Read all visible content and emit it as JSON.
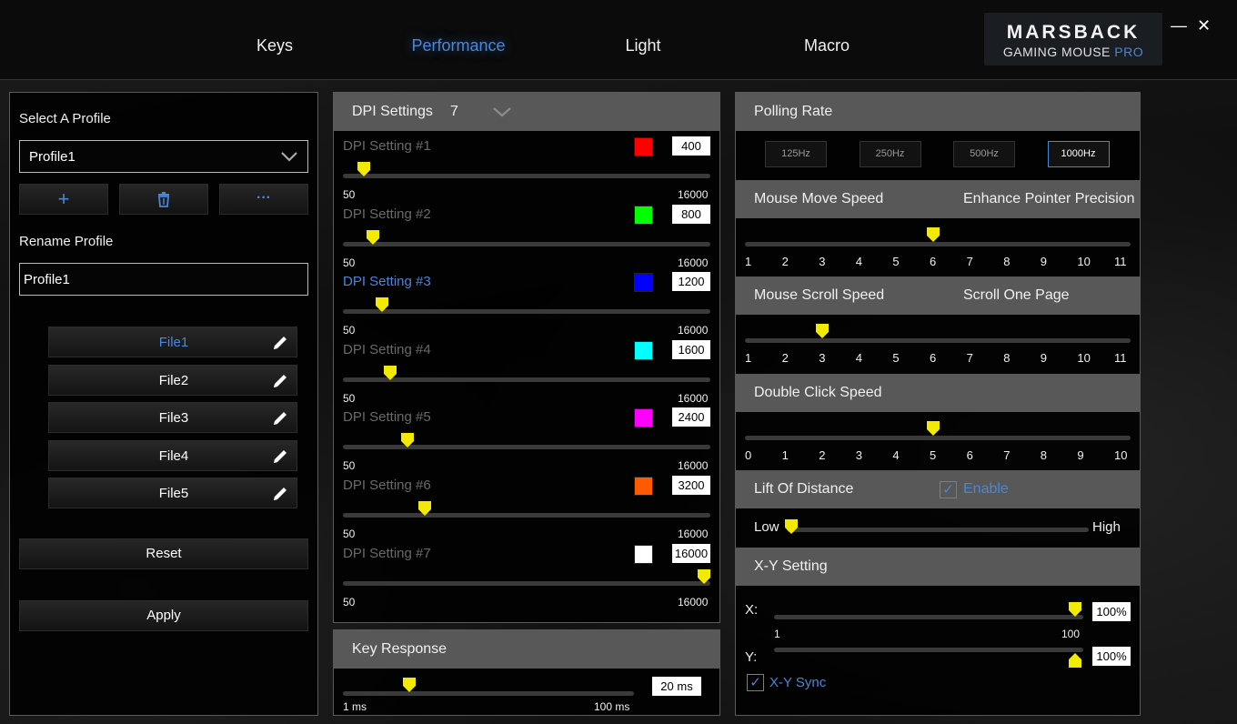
{
  "nav": {
    "tabs": [
      "Keys",
      "Performance",
      "Light",
      "Macro"
    ],
    "active": "Performance"
  },
  "logo": {
    "brand": "MARSBACK",
    "line": "GAMING MOUSE",
    "pro": "PRO"
  },
  "window": {
    "minimize": "—",
    "close": "✕"
  },
  "profile": {
    "select_label": "Select A Profile",
    "selected": "Profile1",
    "actions": {
      "add": "+",
      "delete": "🗑",
      "more": "···"
    },
    "rename_label": "Rename Profile",
    "rename_value": "Profile1",
    "files": [
      "File1",
      "File2",
      "File3",
      "File4",
      "File5"
    ],
    "active_file": "File1",
    "reset": "Reset",
    "apply": "Apply"
  },
  "dpi": {
    "header": "DPI Settings",
    "count": "7",
    "min_label": "50",
    "max_label": "16000",
    "settings": [
      {
        "label": "DPI Setting #1",
        "color": "#ff0000",
        "value": "400"
      },
      {
        "label": "DPI Setting #2",
        "color": "#00ff00",
        "value": "800"
      },
      {
        "label": "DPI Setting #3",
        "color": "#0000ff",
        "value": "1200"
      },
      {
        "label": "DPI Setting #4",
        "color": "#00ffff",
        "value": "1600"
      },
      {
        "label": "DPI Setting #5",
        "color": "#ff00ff",
        "value": "2400"
      },
      {
        "label": "DPI Setting #6",
        "color": "#ff5a00",
        "value": "3200"
      },
      {
        "label": "DPI Setting #7",
        "color": "#ffffff",
        "value": "16000"
      }
    ],
    "active_index": 2
  },
  "key_response": {
    "header": "Key Response",
    "value": "20 ms",
    "min_label": "1 ms",
    "max_label": "100 ms",
    "level": 0.2
  },
  "polling": {
    "header": "Polling Rate",
    "options": [
      "125Hz",
      "250Hz",
      "500Hz",
      "1000Hz"
    ],
    "active": "1000Hz"
  },
  "move_speed": {
    "header": "Mouse Move Speed",
    "extra": "Enhance Pointer Precision",
    "scale": [
      "1",
      "2",
      "3",
      "4",
      "5",
      "6",
      "7",
      "8",
      "9",
      "10",
      "11"
    ],
    "value": 6
  },
  "scroll_speed": {
    "header": "Mouse Scroll Speed",
    "extra": "Scroll One Page",
    "scale": [
      "1",
      "2",
      "3",
      "4",
      "5",
      "6",
      "7",
      "8",
      "9",
      "10",
      "11"
    ],
    "value": 3
  },
  "double_click": {
    "header": "Double Click Speed",
    "scale": [
      "0",
      "1",
      "2",
      "3",
      "4",
      "5",
      "6",
      "7",
      "8",
      "9",
      "10"
    ],
    "value": 5
  },
  "lift": {
    "header": "Lift Of Distance",
    "enable": "Enable",
    "low": "Low",
    "high": "High",
    "level": 0
  },
  "xy": {
    "header": "X-Y Setting",
    "x_label": "X:",
    "y_label": "Y:",
    "x_value": "100%",
    "y_value": "100%",
    "min_label": "1",
    "max_label": "100",
    "sync": "X-Y Sync"
  },
  "colors": {
    "accent": "#4a86d8",
    "thumb": "#f2ea00",
    "section": "#585858"
  }
}
